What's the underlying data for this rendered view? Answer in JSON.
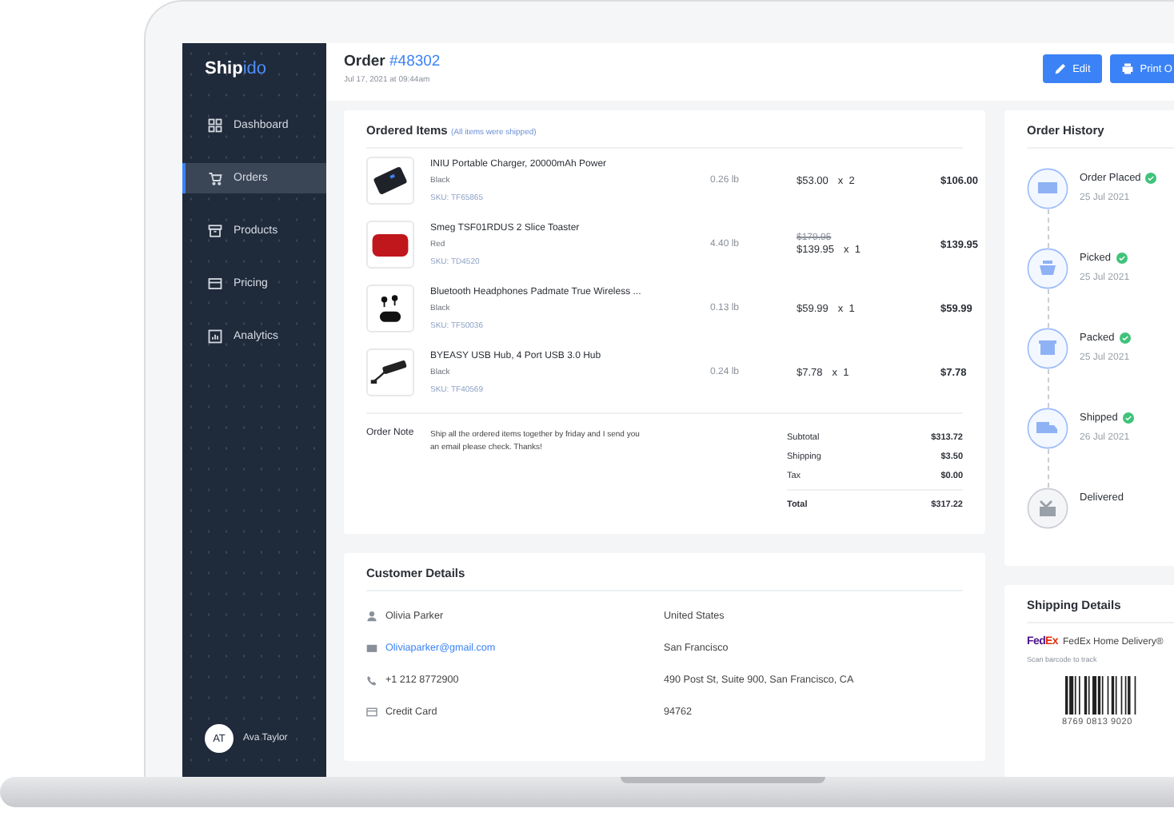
{
  "sidebar": {
    "logo": {
      "part_1": "Ship",
      "part_2": "ido"
    },
    "items": [
      {
        "label": "Dashboard",
        "kind": "grid",
        "selected": false
      },
      {
        "label": "Orders",
        "kind": "cart",
        "selected": true
      },
      {
        "label": "Products",
        "kind": "archive",
        "selected": false
      },
      {
        "label": "Pricing",
        "kind": "card",
        "selected": false
      },
      {
        "label": "Analytics",
        "kind": "chart",
        "selected": false
      }
    ],
    "user": {
      "initials": "AT",
      "name": "Ava Taylor"
    }
  },
  "header": {
    "title": "Order",
    "order_number": "#48302",
    "date": "Jul 17, 2021 at 09:44am",
    "buttons": [
      {
        "label": "Edit",
        "kind": "edit"
      },
      {
        "label": "Print O",
        "kind": "print"
      }
    ]
  },
  "ordered_items": {
    "title": "Ordered Items",
    "subtitle": "(All items were shipped)",
    "items": [
      {
        "kind": "charger",
        "name": "INIU Portable Charger, 20000mAh Power",
        "variant": "Black",
        "sku": "SKU: TF65865",
        "weight": "0.26 lb",
        "price": "$53.00",
        "qty": "x  2",
        "total": "$106.00"
      },
      {
        "kind": "toaster",
        "name": "Smeg TSF01RDUS 2 Slice Toaster",
        "variant": "Red",
        "sku": "SKU: TD4520",
        "weight": "4.40 lb",
        "original_price": "$179.95",
        "price": "$139.95",
        "qty": "x  1",
        "total": "$139.95"
      },
      {
        "kind": "earbuds",
        "name": "Bluetooth Headphones Padmate True Wireless ...",
        "variant": "Black",
        "sku": "SKU: TF50036",
        "weight": "0.13 lb",
        "price": "$59.99",
        "qty": "x  1",
        "total": "$59.99"
      },
      {
        "kind": "hub",
        "name": "BYEASY USB Hub, 4 Port USB 3.0 Hub",
        "variant": "Black",
        "sku": "SKU: TF40569",
        "weight": "0.24 lb",
        "price": "$7.78",
        "qty": "x  1",
        "total": "$7.78"
      }
    ],
    "note_label": "Order Note",
    "note": "Ship all the ordered items together by friday and I send you an email please check. Thanks!",
    "totals": [
      {
        "kind": "line",
        "label": "Subtotal",
        "value": "$313.72"
      },
      {
        "kind": "line",
        "label": "Shipping",
        "value": "$3.50"
      },
      {
        "kind": "line",
        "label": "Tax",
        "value": "$0.00"
      },
      {
        "kind": "total",
        "label": "Total",
        "value": "$317.22"
      }
    ]
  },
  "customer_details": {
    "title": "Customer Details",
    "contacts": [
      {
        "kind": "person",
        "text": "Olivia Parker"
      },
      {
        "kind": "email",
        "text": "Oliviaparker@gmail.com"
      },
      {
        "kind": "phone",
        "text": "+1 212 8772900"
      },
      {
        "kind": "card",
        "text": "Credit Card"
      }
    ],
    "address": [
      "United States",
      "San Francisco",
      "490 Post St, Suite 900, San Francisco, CA",
      "94762"
    ]
  },
  "order_history": {
    "title": "Order History",
    "steps": [
      {
        "kind": "placed",
        "label": "Order Placed",
        "date": "25 Jul 2021",
        "done": true
      },
      {
        "kind": "picked",
        "label": "Picked",
        "date": "25 Jul 2021",
        "done": true
      },
      {
        "kind": "packed",
        "label": "Packed",
        "date": "25 Jul 2021",
        "done": true
      },
      {
        "kind": "shipped",
        "label": "Shipped",
        "date": "26 Jul 2021",
        "done": true
      },
      {
        "kind": "delivered",
        "label": "Delivered",
        "done": false
      }
    ]
  },
  "shipping_details": {
    "title": "Shipping Details",
    "carrier_logo": {
      "part_1": "Fed",
      "part_2": "Ex"
    },
    "service": "FedEx Home Delivery®",
    "hint": "Scan barcode to track",
    "tracking_number": "8769 0813 9020"
  }
}
